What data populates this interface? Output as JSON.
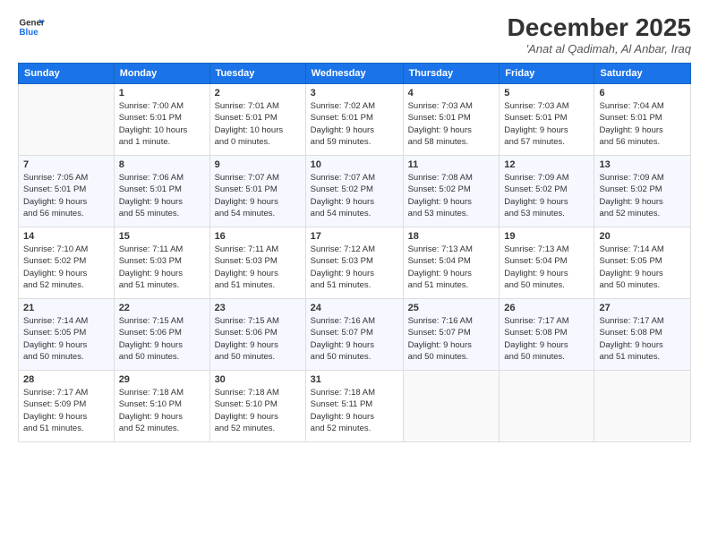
{
  "logo": {
    "line1": "General",
    "line2": "Blue"
  },
  "title": "December 2025",
  "location": "'Anat al Qadimah, Al Anbar, Iraq",
  "headers": [
    "Sunday",
    "Monday",
    "Tuesday",
    "Wednesday",
    "Thursday",
    "Friday",
    "Saturday"
  ],
  "weeks": [
    [
      {
        "num": "",
        "info": ""
      },
      {
        "num": "1",
        "info": "Sunrise: 7:00 AM\nSunset: 5:01 PM\nDaylight: 10 hours\nand 1 minute."
      },
      {
        "num": "2",
        "info": "Sunrise: 7:01 AM\nSunset: 5:01 PM\nDaylight: 10 hours\nand 0 minutes."
      },
      {
        "num": "3",
        "info": "Sunrise: 7:02 AM\nSunset: 5:01 PM\nDaylight: 9 hours\nand 59 minutes."
      },
      {
        "num": "4",
        "info": "Sunrise: 7:03 AM\nSunset: 5:01 PM\nDaylight: 9 hours\nand 58 minutes."
      },
      {
        "num": "5",
        "info": "Sunrise: 7:03 AM\nSunset: 5:01 PM\nDaylight: 9 hours\nand 57 minutes."
      },
      {
        "num": "6",
        "info": "Sunrise: 7:04 AM\nSunset: 5:01 PM\nDaylight: 9 hours\nand 56 minutes."
      }
    ],
    [
      {
        "num": "7",
        "info": "Sunrise: 7:05 AM\nSunset: 5:01 PM\nDaylight: 9 hours\nand 56 minutes."
      },
      {
        "num": "8",
        "info": "Sunrise: 7:06 AM\nSunset: 5:01 PM\nDaylight: 9 hours\nand 55 minutes."
      },
      {
        "num": "9",
        "info": "Sunrise: 7:07 AM\nSunset: 5:01 PM\nDaylight: 9 hours\nand 54 minutes."
      },
      {
        "num": "10",
        "info": "Sunrise: 7:07 AM\nSunset: 5:02 PM\nDaylight: 9 hours\nand 54 minutes."
      },
      {
        "num": "11",
        "info": "Sunrise: 7:08 AM\nSunset: 5:02 PM\nDaylight: 9 hours\nand 53 minutes."
      },
      {
        "num": "12",
        "info": "Sunrise: 7:09 AM\nSunset: 5:02 PM\nDaylight: 9 hours\nand 53 minutes."
      },
      {
        "num": "13",
        "info": "Sunrise: 7:09 AM\nSunset: 5:02 PM\nDaylight: 9 hours\nand 52 minutes."
      }
    ],
    [
      {
        "num": "14",
        "info": "Sunrise: 7:10 AM\nSunset: 5:02 PM\nDaylight: 9 hours\nand 52 minutes."
      },
      {
        "num": "15",
        "info": "Sunrise: 7:11 AM\nSunset: 5:03 PM\nDaylight: 9 hours\nand 51 minutes."
      },
      {
        "num": "16",
        "info": "Sunrise: 7:11 AM\nSunset: 5:03 PM\nDaylight: 9 hours\nand 51 minutes."
      },
      {
        "num": "17",
        "info": "Sunrise: 7:12 AM\nSunset: 5:03 PM\nDaylight: 9 hours\nand 51 minutes."
      },
      {
        "num": "18",
        "info": "Sunrise: 7:13 AM\nSunset: 5:04 PM\nDaylight: 9 hours\nand 51 minutes."
      },
      {
        "num": "19",
        "info": "Sunrise: 7:13 AM\nSunset: 5:04 PM\nDaylight: 9 hours\nand 50 minutes."
      },
      {
        "num": "20",
        "info": "Sunrise: 7:14 AM\nSunset: 5:05 PM\nDaylight: 9 hours\nand 50 minutes."
      }
    ],
    [
      {
        "num": "21",
        "info": "Sunrise: 7:14 AM\nSunset: 5:05 PM\nDaylight: 9 hours\nand 50 minutes."
      },
      {
        "num": "22",
        "info": "Sunrise: 7:15 AM\nSunset: 5:06 PM\nDaylight: 9 hours\nand 50 minutes."
      },
      {
        "num": "23",
        "info": "Sunrise: 7:15 AM\nSunset: 5:06 PM\nDaylight: 9 hours\nand 50 minutes."
      },
      {
        "num": "24",
        "info": "Sunrise: 7:16 AM\nSunset: 5:07 PM\nDaylight: 9 hours\nand 50 minutes."
      },
      {
        "num": "25",
        "info": "Sunrise: 7:16 AM\nSunset: 5:07 PM\nDaylight: 9 hours\nand 50 minutes."
      },
      {
        "num": "26",
        "info": "Sunrise: 7:17 AM\nSunset: 5:08 PM\nDaylight: 9 hours\nand 50 minutes."
      },
      {
        "num": "27",
        "info": "Sunrise: 7:17 AM\nSunset: 5:08 PM\nDaylight: 9 hours\nand 51 minutes."
      }
    ],
    [
      {
        "num": "28",
        "info": "Sunrise: 7:17 AM\nSunset: 5:09 PM\nDaylight: 9 hours\nand 51 minutes."
      },
      {
        "num": "29",
        "info": "Sunrise: 7:18 AM\nSunset: 5:10 PM\nDaylight: 9 hours\nand 52 minutes."
      },
      {
        "num": "30",
        "info": "Sunrise: 7:18 AM\nSunset: 5:10 PM\nDaylight: 9 hours\nand 52 minutes."
      },
      {
        "num": "31",
        "info": "Sunrise: 7:18 AM\nSunset: 5:11 PM\nDaylight: 9 hours\nand 52 minutes."
      },
      {
        "num": "",
        "info": ""
      },
      {
        "num": "",
        "info": ""
      },
      {
        "num": "",
        "info": ""
      }
    ]
  ]
}
